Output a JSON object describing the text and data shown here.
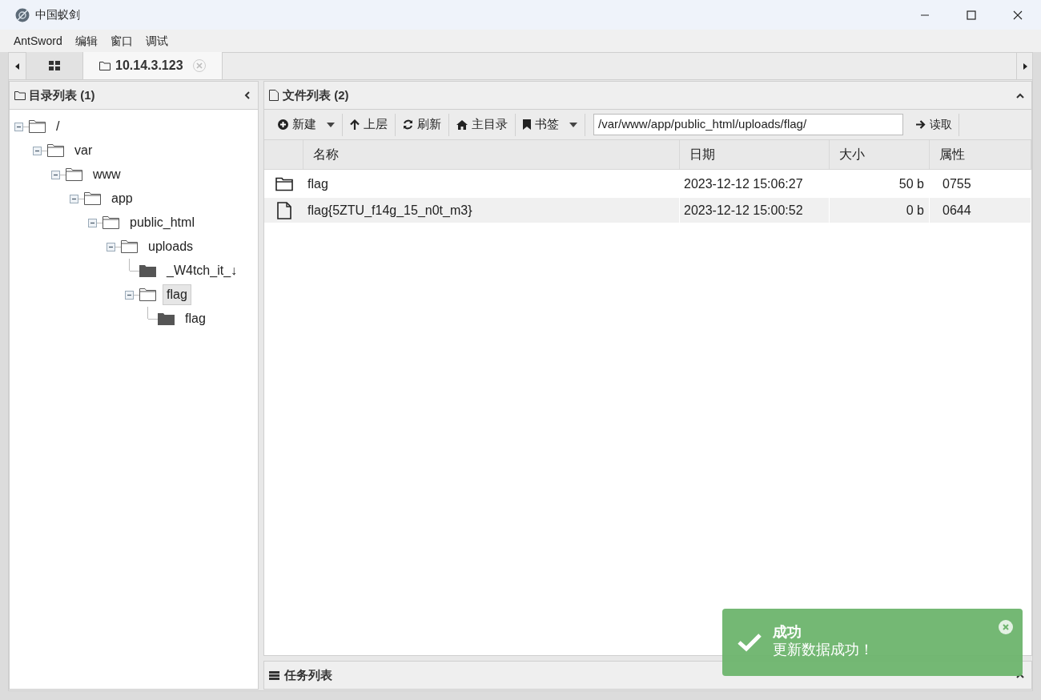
{
  "window": {
    "title": "中国蚁剑"
  },
  "menu": [
    "AntSword",
    "编辑",
    "窗口",
    "调试"
  ],
  "tabs": [
    {
      "kind": "grid",
      "selected": false
    },
    {
      "kind": "host",
      "label": "10.14.3.123",
      "selected": true
    }
  ],
  "dir_panel": {
    "title": "目录列表 (1)"
  },
  "tree": [
    {
      "name": "/",
      "kind": "outline",
      "expanded": true,
      "selected": false,
      "children": [
        {
          "name": "var",
          "kind": "outline",
          "expanded": true,
          "selected": false,
          "children": [
            {
              "name": "www",
              "kind": "outline",
              "expanded": true,
              "selected": false,
              "children": [
                {
                  "name": "app",
                  "kind": "outline",
                  "expanded": true,
                  "selected": false,
                  "children": [
                    {
                      "name": "public_html",
                      "kind": "outline",
                      "expanded": true,
                      "selected": false,
                      "children": [
                        {
                          "name": "uploads",
                          "kind": "outline",
                          "expanded": true,
                          "selected": false,
                          "children": [
                            {
                              "name": "_W4tch_it_↓",
                              "kind": "filled",
                              "selected": false
                            },
                            {
                              "name": "flag",
                              "kind": "outline",
                              "expanded": true,
                              "selected": true,
                              "children": [
                                {
                                  "name": "flag",
                                  "kind": "filled",
                                  "selected": false
                                }
                              ]
                            }
                          ]
                        }
                      ]
                    }
                  ]
                }
              ]
            }
          ]
        }
      ]
    }
  ],
  "file_panel": {
    "title": "文件列表 (2)"
  },
  "toolbar": [
    {
      "kind": "new",
      "label": "新建",
      "dropdown": true
    },
    {
      "kind": "up",
      "label": "上层",
      "dropdown": false
    },
    {
      "kind": "refresh",
      "label": "刷新",
      "dropdown": false
    },
    {
      "kind": "home",
      "label": "主目录",
      "dropdown": false
    },
    {
      "kind": "bookmark",
      "label": "书签",
      "dropdown": true
    }
  ],
  "path_field": {
    "value": "/var/www/app/public_html/uploads/flag/"
  },
  "read_button": "读取",
  "table": {
    "columns": [
      "名称",
      "日期",
      "大小",
      "属性"
    ],
    "rows": [
      {
        "kind": "folder",
        "name": "flag",
        "date": "2023-12-12 15:06:27",
        "size": "50 b",
        "perm": "0755"
      },
      {
        "kind": "file",
        "name": "flag{5ZTU_f14g_15_n0t_m3}",
        "date": "2023-12-12 15:00:52",
        "size": "0 b",
        "perm": "0644"
      }
    ]
  },
  "task_panel": {
    "title": "任务列表"
  },
  "toast": {
    "title": "成功",
    "message": "更新数据成功！"
  }
}
